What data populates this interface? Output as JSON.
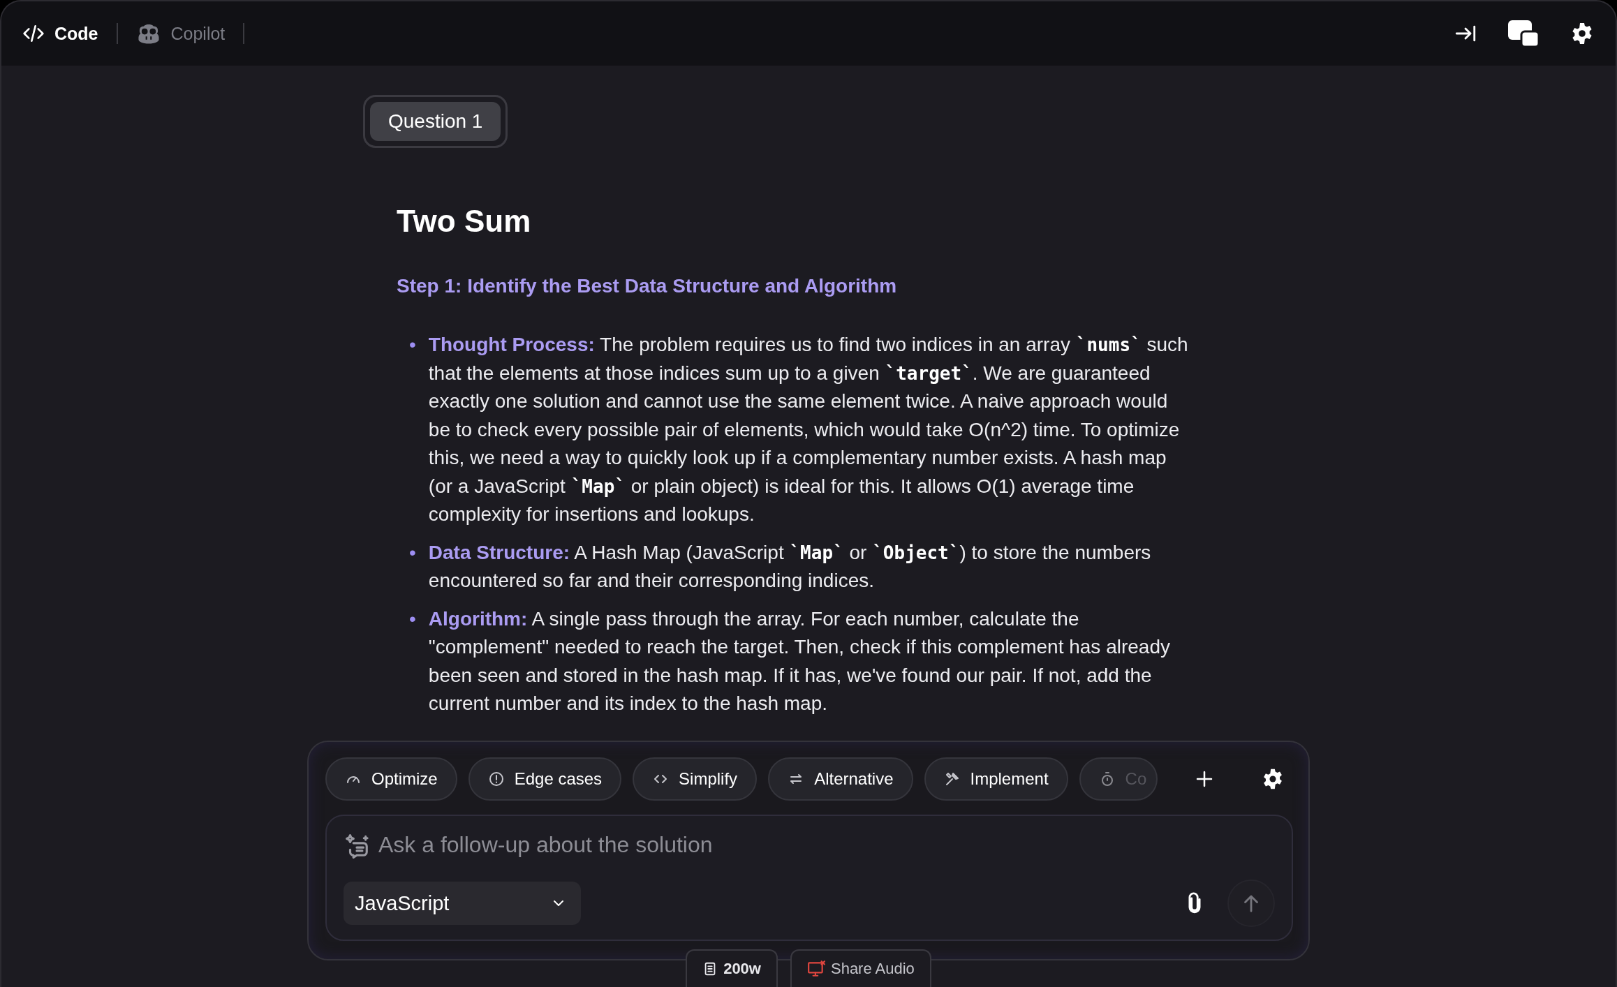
{
  "toolbar": {
    "tabs": [
      {
        "label": "Code",
        "selected": true
      },
      {
        "label": "Copilot",
        "selected": false
      }
    ]
  },
  "question_tag": "Question 1",
  "title": "Two Sum",
  "step_heading": "Step 1: Identify the Best Data Structure and Algorithm",
  "bullets": [
    {
      "marker": "•",
      "label": "Thought Process:",
      "segments": [
        {
          "kind": "text",
          "text": "The problem requires us to find two indices in an array "
        },
        {
          "kind": "code",
          "text": "`nums`"
        },
        {
          "kind": "text",
          "text": " such that the elements at those indices sum up to a given "
        },
        {
          "kind": "code",
          "text": "`target`"
        },
        {
          "kind": "text",
          "text": ". We are guaranteed exactly one solution and cannot use the same element twice. A naive approach would be to check every possible pair of elements, which would take O(n^2) time. To optimize this, we need a way to quickly look up if a complementary number exists. A hash map (or a JavaScript "
        },
        {
          "kind": "code",
          "text": "`Map`"
        },
        {
          "kind": "text",
          "text": " or plain object) is ideal for this. It allows O(1) average time complexity for insertions and lookups."
        }
      ]
    },
    {
      "marker": "•",
      "label": "Data Structure:",
      "segments": [
        {
          "kind": "text",
          "text": "A Hash Map (JavaScript "
        },
        {
          "kind": "code",
          "text": "`Map`"
        },
        {
          "kind": "text",
          "text": " or "
        },
        {
          "kind": "code",
          "text": "`Object`"
        },
        {
          "kind": "text",
          "text": ") to store the numbers encountered so far and their corresponding indices."
        }
      ]
    },
    {
      "marker": "•",
      "label": "Algorithm:",
      "segments": [
        {
          "kind": "text",
          "text": "A single pass through the array. For each number, calculate the \"complement\" needed to reach the target. Then, check if this complement has already been seen and stored in the hash map. If it has, we've found our pair. If not, add the current number and its index to the hash map."
        }
      ]
    }
  ],
  "chips": [
    "Optimize",
    "Edge cases",
    "Simplify",
    "Alternative",
    "Implement",
    "Co"
  ],
  "composer": {
    "placeholder": "Ask a follow-up about the solution",
    "language": "JavaScript"
  },
  "footer_tabs": [
    "200w",
    "Share Audio"
  ]
}
